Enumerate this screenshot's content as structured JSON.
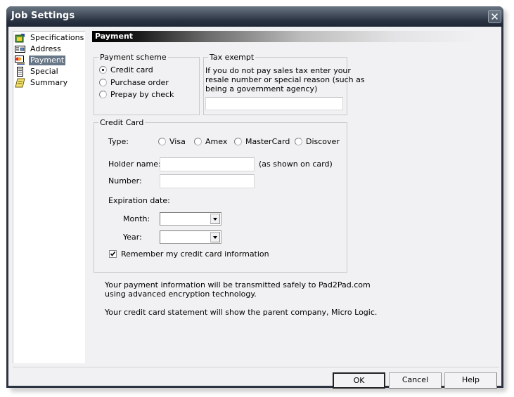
{
  "window": {
    "title": "Job Settings",
    "close_icon": "close-icon"
  },
  "sidebar": {
    "items": [
      {
        "label": "Specifications",
        "icon": "specifications-icon",
        "selected": false
      },
      {
        "label": "Address",
        "icon": "address-card-icon",
        "selected": false
      },
      {
        "label": "Payment",
        "icon": "payment-card-icon",
        "selected": true
      },
      {
        "label": "Special",
        "icon": "special-list-icon",
        "selected": false
      },
      {
        "label": "Summary",
        "icon": "summary-notepad-icon",
        "selected": false
      }
    ]
  },
  "page": {
    "header": "Payment",
    "payment_scheme": {
      "label": "Payment scheme",
      "options": [
        {
          "label": "Credit card",
          "checked": true
        },
        {
          "label": "Purchase order",
          "checked": false
        },
        {
          "label": "Prepay by check",
          "checked": false
        }
      ]
    },
    "tax_exempt": {
      "label": "Tax exempt",
      "description_lines": [
        "If you do not pay sales tax enter your",
        "resale number or special reason (such as",
        "being a government agency)"
      ],
      "value": ""
    },
    "credit_card": {
      "label": "Credit Card",
      "type_label": "Type:",
      "types": [
        {
          "label": "Visa",
          "checked": false
        },
        {
          "label": "Amex",
          "checked": false
        },
        {
          "label": "MasterCard",
          "checked": false
        },
        {
          "label": "Discover",
          "checked": false
        }
      ],
      "holder_label": "Holder name:",
      "holder_value": "",
      "holder_hint": "(as shown on card)",
      "number_label": "Number:",
      "number_value": "",
      "expiration_label": "Expiration date:",
      "month_label": "Month:",
      "month_value": "",
      "year_label": "Year:",
      "year_value": "",
      "remember_label": "Remember my credit card information",
      "remember_checked": true
    },
    "notes": {
      "line1": "Your payment information will be transmitted safely to Pad2Pad.com",
      "line2": "using advanced encryption technology.",
      "line3": "Your credit card statement will show the parent company, Micro Logic."
    }
  },
  "buttons": {
    "ok": "OK",
    "cancel": "Cancel",
    "help": "Help"
  }
}
